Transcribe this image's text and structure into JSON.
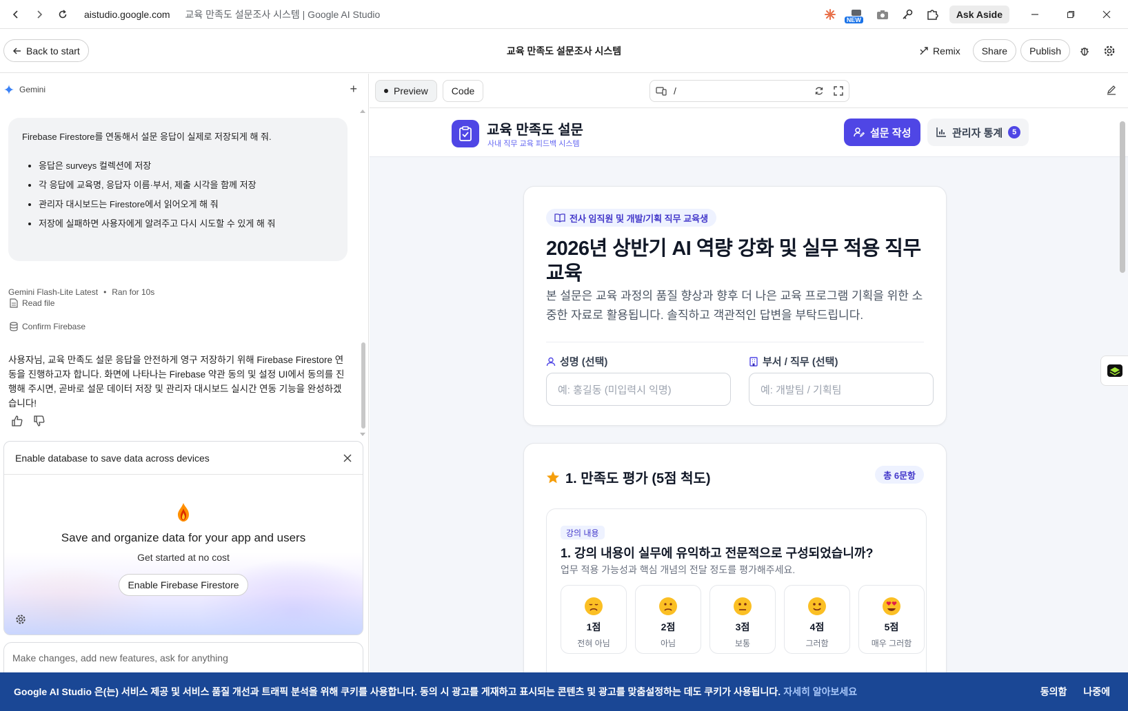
{
  "browser": {
    "url": "aistudio.google.com",
    "page_title": "교육 만족도 설문조사 시스템 | Google AI Studio",
    "new_badge": "NEW",
    "ask_aside": "Ask Aside"
  },
  "app_header": {
    "back_label": "Back to start",
    "title": "교육 만족도 설문조사 시스템",
    "remix_label": "Remix",
    "share_label": "Share",
    "publish_label": "Publish"
  },
  "chat": {
    "model_label": "Gemini",
    "user_message": {
      "intro": "Firebase Firestore를 연동해서 설문 응답이 실제로 저장되게 해 줘.",
      "bullets": [
        "응답은 surveys 컬렉션에 저장",
        "각 응답에 교육명, 응답자 이름·부서, 제출 시각을 함께 저장",
        "관리자 대시보드는 Firestore에서 읽어오게 해 줘",
        "저장에 실패하면 사용자에게 알려주고 다시 시도할 수 있게 해 줘"
      ]
    },
    "run_model": "Gemini Flash-Lite Latest",
    "run_sep": "•",
    "run_time": "Ran for 10s",
    "tool_read": "Read file",
    "tool_confirm": "Confirm Firebase",
    "reply": "사용자님, 교육 만족도 설문 응답을 안전하게 영구 저장하기 위해 Firebase Firestore 연동을 진행하고자 합니다. 화면에 나타나는 Firebase 약관 동의 및 설정 UI에서 동의를 진행해 주시면, 곧바로 설문 데이터 저장 및 관리자 대시보드 실시간 연동 기능을 완성하겠습니다!"
  },
  "firebase_card": {
    "header": "Enable database to save data across devices",
    "heading": "Save and organize data for your app and users",
    "sub": "Get started at no cost",
    "button": "Enable Firebase Firestore"
  },
  "prompt": {
    "placeholder": "Make changes, add new features, ask for anything"
  },
  "preview_tabs": {
    "preview": "Preview",
    "code": "Code",
    "path": "/"
  },
  "site": {
    "title": "교육 만족도 설문",
    "subtitle": "사내 직무 교육 피드백 시스템",
    "nav_write": "설문 작성",
    "nav_stats": "관리자 통계",
    "nav_stats_count": "5",
    "audience_tag": "전사 임직원 및 개발/기획 직무 교육생",
    "course_title": "2026년 상반기 AI 역량 강화 및 실무 적용 직무 교육",
    "course_desc": "본 설문은 교육 과정의 품질 향상과 향후 더 나은 교육 프로그램 기획을 위한 소중한 자료로 활용됩니다. 솔직하고 객관적인 답변을 부탁드립니다.",
    "name_label": "성명 (선택)",
    "name_placeholder": "예: 홍길동 (미입력시 익명)",
    "dept_label": "부서 / 직무 (선택)",
    "dept_placeholder": "예: 개발팀 / 기획팀",
    "section_title": "1. 만족도 평가 (5점 척도)",
    "section_count": "총 6문항",
    "question": {
      "tag": "강의 내용",
      "title": "1. 강의 내용이 실무에 유익하고 전문적으로 구성되었습니까?",
      "sub": "업무 적용 가능성과 핵심 개념의 전달 정도를 평가해주세요.",
      "options": [
        {
          "score": "1점",
          "label": "전혀 아님",
          "icon": "very-sad-face-icon"
        },
        {
          "score": "2점",
          "label": "아님",
          "icon": "sad-face-icon"
        },
        {
          "score": "3점",
          "label": "보통",
          "icon": "neutral-face-icon"
        },
        {
          "score": "4점",
          "label": "그러함",
          "icon": "smile-face-icon"
        },
        {
          "score": "5점",
          "label": "매우 그러함",
          "icon": "heart-eyes-face-icon"
        }
      ]
    }
  },
  "cookie": {
    "text": "Google AI Studio 은(는) 서비스 제공 및 서비스 품질 개선과 트래픽 분석을 위해 쿠키를 사용합니다. 동의 시 광고를 게재하고 표시되는 콘텐츠 및 광고를 맞춤설정하는 데도 쿠키가 사용됩니다.",
    "link": "자세히 알아보세요",
    "accept": "동의함",
    "later": "나중에"
  },
  "colors": {
    "primary": "#4f46e5",
    "cookie_bg": "#1a4795",
    "star": "#f59e0b"
  }
}
